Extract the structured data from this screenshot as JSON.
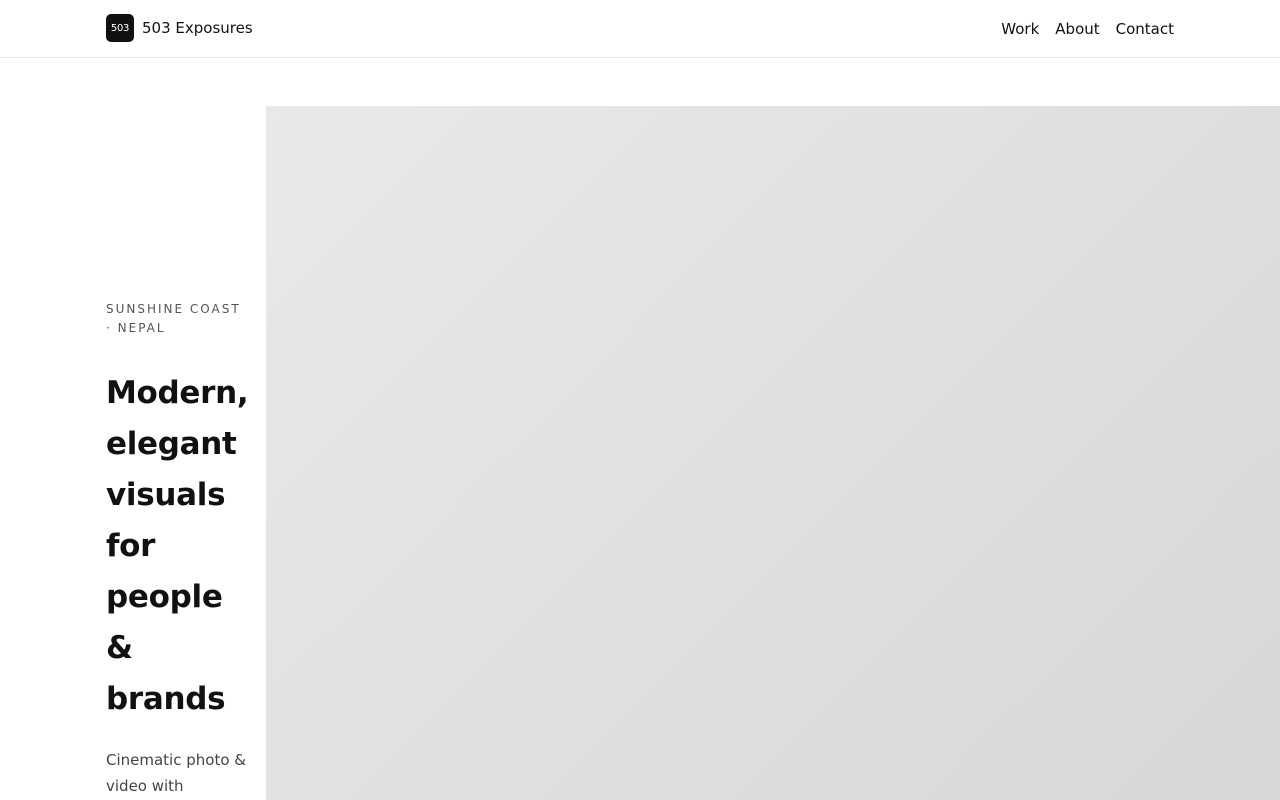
{
  "header": {
    "logo_text": "503",
    "brand_name": "503 Exposures",
    "nav": [
      {
        "label": "Work"
      },
      {
        "label": "About"
      },
      {
        "label": "Contact"
      }
    ]
  },
  "hero": {
    "eyebrow": "SUNSHINE COAST · NEPAL",
    "headline": "Modern, elegant visuals for people & brands",
    "lede": "Cinematic photo & video with"
  },
  "colors": {
    "ink": "#111111",
    "muted": "#555555",
    "border": "#e6e6e6",
    "media_placeholder_start": "#e9e9e9",
    "media_placeholder_end": "#d7d7d7"
  }
}
